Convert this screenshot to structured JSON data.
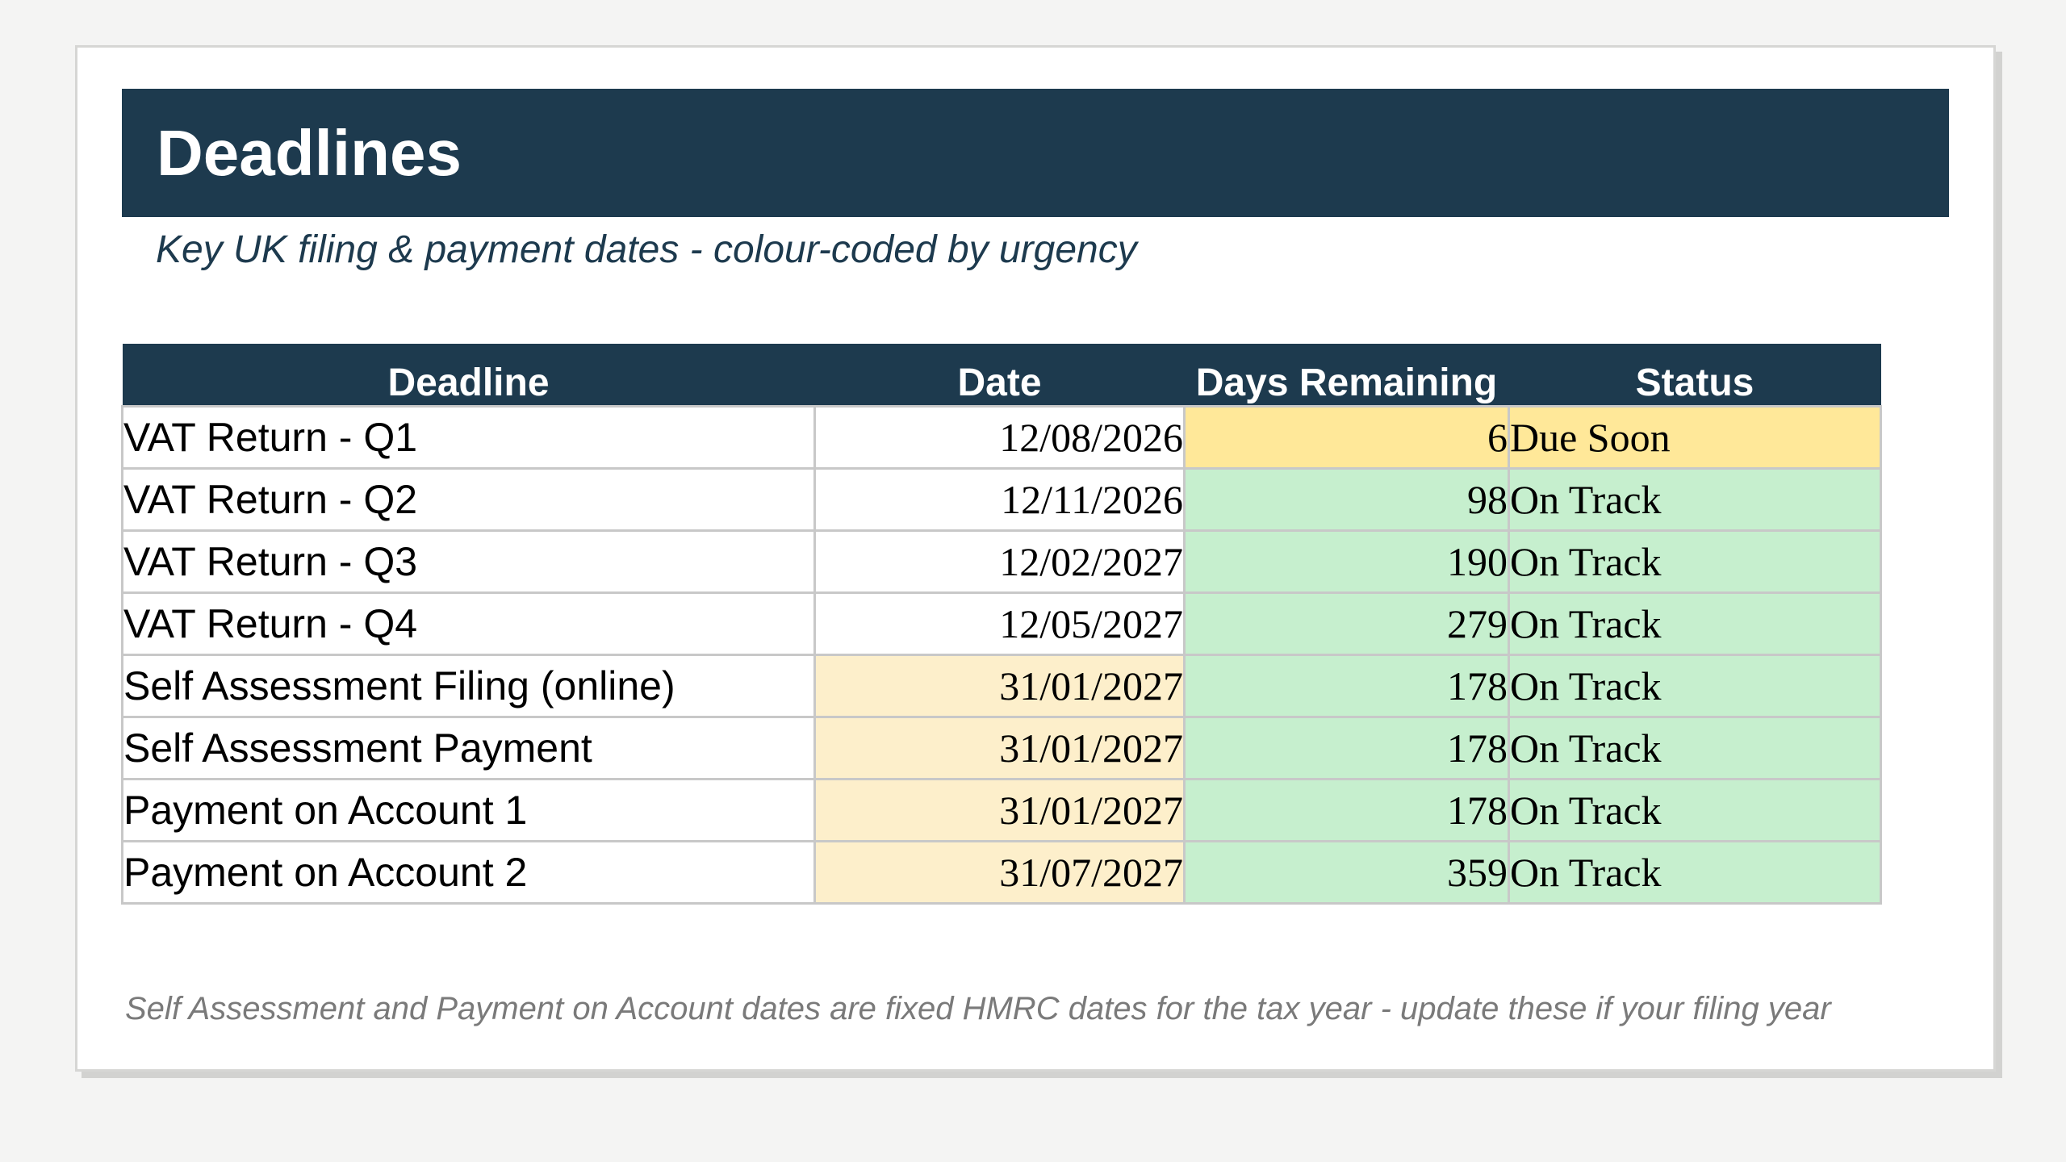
{
  "sheet": {
    "title": "Deadlines",
    "subtitle": "Key UK filing & payment dates - colour-coded by urgency",
    "footnote": "Self Assessment and Payment on Account dates are fixed HMRC dates for the tax year - update these if your filing year"
  },
  "colors": {
    "header_fill": "#1d3a4e",
    "due_soon_fill": "#ffe899",
    "on_track_fill": "#c6efce",
    "fixed_date_fill": "#fdefcb",
    "plain_fill": "#ffffff"
  },
  "table": {
    "headers": {
      "deadline": "Deadline",
      "date": "Date",
      "days_remaining": "Days Remaining",
      "status": "Status"
    },
    "rows": [
      {
        "deadline": "VAT Return - Q1",
        "date": "12/08/2026",
        "days": "6",
        "status": "Due Soon"
      },
      {
        "deadline": "VAT Return - Q2",
        "date": "12/11/2026",
        "days": "98",
        "status": "On Track"
      },
      {
        "deadline": "VAT Return - Q3",
        "date": "12/02/2027",
        "days": "190",
        "status": "On Track"
      },
      {
        "deadline": "VAT Return - Q4",
        "date": "12/05/2027",
        "days": "279",
        "status": "On Track"
      },
      {
        "deadline": "Self Assessment Filing (online)",
        "date": "31/01/2027",
        "days": "178",
        "status": "On Track"
      },
      {
        "deadline": "Self Assessment Payment",
        "date": "31/01/2027",
        "days": "178",
        "status": "On Track"
      },
      {
        "deadline": "Payment on Account 1",
        "date": "31/01/2027",
        "days": "178",
        "status": "On Track"
      },
      {
        "deadline": "Payment on Account 2",
        "date": "31/07/2027",
        "days": "359",
        "status": "On Track"
      }
    ]
  }
}
